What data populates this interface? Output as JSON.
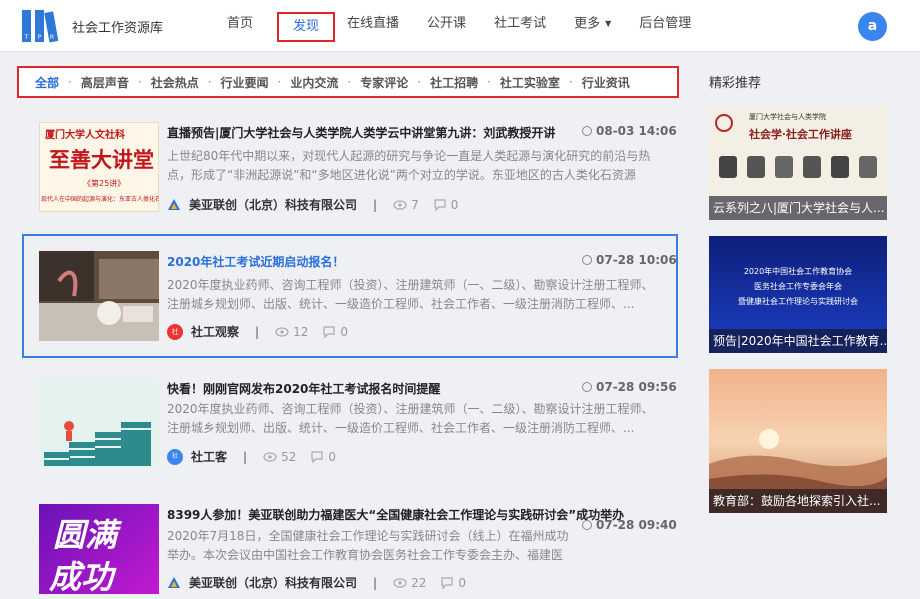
{
  "header": {
    "brand": "社会工作资源库",
    "logo_letters": [
      "T",
      "P",
      "R"
    ],
    "nav": [
      {
        "label": "首页",
        "active": false
      },
      {
        "label": "发现",
        "active": true
      },
      {
        "label": "在线直播",
        "active": false
      },
      {
        "label": "公开课",
        "active": false
      },
      {
        "label": "社工考试",
        "active": false
      },
      {
        "label": "更多",
        "active": false,
        "dropdown": true
      },
      {
        "label": "后台管理",
        "active": false
      }
    ],
    "avatar_letter": "a"
  },
  "categories": [
    "全部",
    "高层声音",
    "社会热点",
    "行业要闻",
    "业内交流",
    "专家评论",
    "社工招聘",
    "社工实验室",
    "行业资讯"
  ],
  "feed": [
    {
      "title": "直播预告|厦门大学社会与人类学院人类学云中讲堂第九讲：刘武教授开讲",
      "time": "08-03 14:06",
      "desc": "上世纪80年代中期以来，对现代人起源的研究与争论一直是人类起源与演化研究的前沿与热点，形成了“非洲起源说”和“多地区进化说”两个对立的学说。东亚地区的古人类化石资源及...",
      "author": "美亚联创（北京）科技有限公司",
      "views": "7",
      "comments": "0",
      "thumb_lines": [
        "厦门大学人文社科",
        "至善大讲堂",
        "《第25讲》",
        "现代人在中国的起源与演化：东亚古人类化石的研究"
      ]
    },
    {
      "title": "2020年社工考试近期启动报名！",
      "time": "07-28 10:06",
      "desc": "2020年度执业药师、咨询工程师（投资）、注册建筑师（一、二级）、勘察设计注册工程师、注册城乡规划师、出版、统计、一级造价工程师、社会工作者、一级注册消防工程师、...",
      "author": "社工观察",
      "views": "12",
      "comments": "0"
    },
    {
      "title": "快看！刚刚官网发布2020年社工考试报名时间提醒",
      "time": "07-28 09:56",
      "desc": "2020年度执业药师、咨询工程师（投资）、注册建筑师（一、二级）、勘察设计注册工程师、注册城乡规划师、出版、统计、一级造价工程师、社会工作者、一级注册消防工程师、...",
      "author": "社工客",
      "views": "52",
      "comments": "0"
    },
    {
      "title": "8399人参加！美亚联创助力福建医大“全国健康社会工作理论与实践研讨会”成功举办",
      "time": "07-28 09:40",
      "desc": "2020年7月18日，全国健康社会工作理论与实践研讨会（线上）在福州成功举办。本次会议由中国社会工作教育协会医务社会工作专委会主办、福建医科...",
      "author": "美亚联创（北京）科技有限公司",
      "views": "22",
      "comments": "0",
      "thumb_lines": [
        "圆满",
        "成功"
      ]
    }
  ],
  "sidebar": {
    "title": "精彩推荐",
    "items": [
      {
        "caption": "云系列之八|厦门大学社会与人...",
        "img_lines": [
          "厦门大学社会与人类学院",
          "社会学·社会工作讲座"
        ]
      },
      {
        "caption": "预告|2020年中国社会工作教育...",
        "img_lines": [
          "2020年中国社会工作教育协会",
          "医务社会工作专委会年会",
          "暨健康社会工作理论与实践研讨会"
        ]
      },
      {
        "caption": "教育部：鼓励各地探索引入社..."
      }
    ]
  },
  "colors": {
    "accent": "#2a6fd9",
    "highlight_red": "#e0262b",
    "highlight_blue": "#3a7fe0",
    "avatar": "#3a86f0"
  }
}
